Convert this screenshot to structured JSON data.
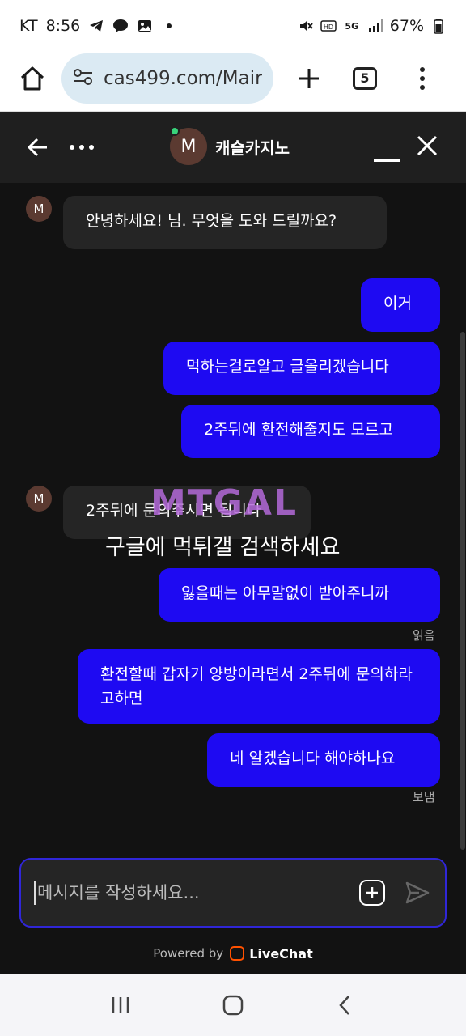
{
  "status_bar": {
    "carrier": "KT",
    "time": "8:56",
    "battery": "67%",
    "network": "5G"
  },
  "browser": {
    "url": "cas499.com/Mair",
    "tab_count": "5"
  },
  "chat_header": {
    "avatar_letter": "M",
    "agent_name": "캐슬카지노"
  },
  "messages": [
    {
      "sender": "agent",
      "avatar": "M",
      "text": "안녕하세요! 님. 무엇을 도와 드릴까요?"
    },
    {
      "sender": "user",
      "text": "이거"
    },
    {
      "sender": "user",
      "text": "먹하는걸로알고 글올리겠습니다"
    },
    {
      "sender": "user",
      "text": "2주뒤에 환전해줄지도 모르고"
    },
    {
      "sender": "agent",
      "avatar": "M",
      "text": "2주뒤에 문의주시면 됩니다"
    },
    {
      "sender": "user",
      "text": "잃을때는 아무말없이 받아주니까"
    },
    {
      "sender": "user",
      "text": "환전할때 갑자기 양방이라면서 2주뒤에 문의하라고하면"
    },
    {
      "sender": "user",
      "text": "네 알겠습니다 해야하나요"
    }
  ],
  "meta": {
    "read_label": "읽음",
    "sent_label": "보냄"
  },
  "watermark": {
    "logo": "MTGAL",
    "caption": "구글에 먹튀갤 검색하세요"
  },
  "composer": {
    "placeholder": "메시지를 작성하세요..."
  },
  "footer": {
    "powered_by": "Powered by",
    "brand": "LiveChat"
  },
  "colors": {
    "user_bubble": "#1e0af2",
    "agent_bubble": "#252525",
    "background": "#121212",
    "livechat_accent": "#ff5100"
  }
}
